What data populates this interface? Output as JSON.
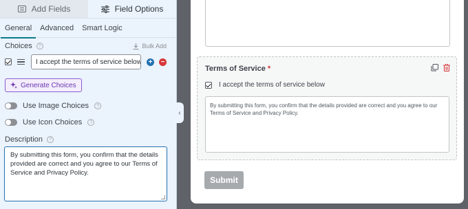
{
  "left_panel": {
    "tabs": {
      "add_fields": "Add Fields",
      "field_options": "Field Options"
    },
    "subtabs": {
      "general": "General",
      "advanced": "Advanced",
      "smart_logic": "Smart Logic"
    },
    "choices": {
      "label": "Choices",
      "bulk_add": "Bulk Add",
      "items": [
        {
          "value": "I accept the terms of service below",
          "checked": true
        }
      ]
    },
    "generate_choices": "Generate Choices",
    "use_image_choices": {
      "label": "Use Image Choices",
      "enabled": false
    },
    "use_icon_choices": {
      "label": "Use Icon Choices",
      "enabled": false
    },
    "description": {
      "label": "Description",
      "value": "By submitting this form, you confirm that the details provided are correct and you agree to our Terms of Service and Privacy Policy."
    }
  },
  "preview": {
    "field_title": "Terms of Service",
    "required_mark": "*",
    "checkbox_label": "I accept the terms of service below",
    "terms_text": "By submitting this form, you confirm that the details provided are correct and you agree to our Terms of Service and Privacy Policy.",
    "submit_label": "Submit"
  },
  "icons": [
    "list-icon",
    "sliders-icon",
    "help-icon",
    "download-icon",
    "drag-handle-icon",
    "plus-icon",
    "minus-icon",
    "sparkle-icon",
    "chevron-left-icon",
    "duplicate-icon",
    "trash-icon"
  ],
  "colors": {
    "accent": "#2271b1",
    "danger": "#d63638",
    "ai_purple": "#6a34b0",
    "panel_bg": "#ebf3fc",
    "canvas_bg": "#5f6268"
  }
}
